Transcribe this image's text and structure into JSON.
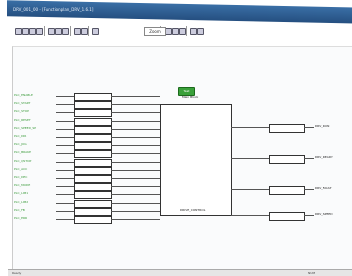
{
  "window": {
    "title": "DRV_001_00 - [Functionplan_DRV_1.6.1]"
  },
  "toolbar": {
    "zoom_value": "Zoom",
    "icons": [
      "new-icon",
      "open-icon",
      "save-icon",
      "print-icon",
      "cut-icon",
      "copy-icon",
      "paste-icon",
      "undo-icon",
      "redo-icon",
      "find-icon",
      "zoom-in-icon",
      "zoom-out-icon",
      "grid-icon",
      "settings-icon",
      "help-icon"
    ]
  },
  "diagram": {
    "green_button_label": "Test",
    "main_block_label": "Main Block",
    "center_block_name": "DRIVE_CONTROL",
    "left_signals": [
      "PLC_ENABLE",
      "PLC_START",
      "PLC_STOP",
      "PLC_RESET",
      "PLC_SPEED_SP",
      "PLC_DIR",
      "PLC_JOG",
      "PLC_BRAKE",
      "PLC_QSTOP",
      "PLC_ACC",
      "PLC_DEC",
      "PLC_MODE",
      "PLC_LIM1",
      "PLC_LIM2",
      "PLC_FB",
      "PLC_ERR"
    ],
    "right_outputs": [
      "DRV_RUN",
      "DRV_READY",
      "DRV_FAULT",
      "DRV_SPEED"
    ]
  },
  "statusbar": {
    "left": "Ready",
    "middle": "",
    "right": "NUM"
  }
}
